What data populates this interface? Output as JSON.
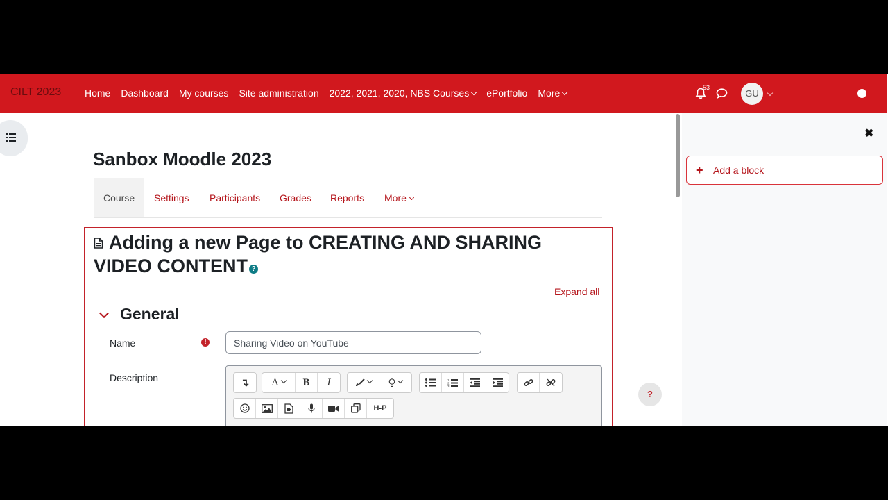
{
  "navbar": {
    "brand": "CILT 2023",
    "links": [
      "Home",
      "Dashboard",
      "My courses",
      "Site administration",
      "2022, 2021, 2020, NBS Courses",
      "ePortfolio",
      "More"
    ],
    "notification_count": "53",
    "avatar_initials": "GU"
  },
  "course": {
    "title": "Sanbox Moodle 2023",
    "tabs": [
      "Course",
      "Settings",
      "Participants",
      "Grades",
      "Reports",
      "More"
    ]
  },
  "form": {
    "heading": "Adding a new Page to CREATING AND SHARING VIDEO CONTENT",
    "expand_all": "Expand all",
    "section_title": "General",
    "name_label": "Name",
    "name_value": "Sharing Video on YouTube",
    "description_label": "Description"
  },
  "editor": {
    "row1": [
      "↴",
      "A",
      "B",
      "I",
      "brush",
      "bulb",
      "ul",
      "ol",
      "outdent",
      "indent",
      "link",
      "unlink"
    ],
    "row2_icons": [
      "emoji-icon",
      "image-icon",
      "media-icon",
      "microphone-icon",
      "video-icon",
      "copy-icon",
      "h5p-icon"
    ],
    "h5p_label": "H-P"
  },
  "drawer": {
    "add_block": "Add a block"
  },
  "help_button": "?"
}
